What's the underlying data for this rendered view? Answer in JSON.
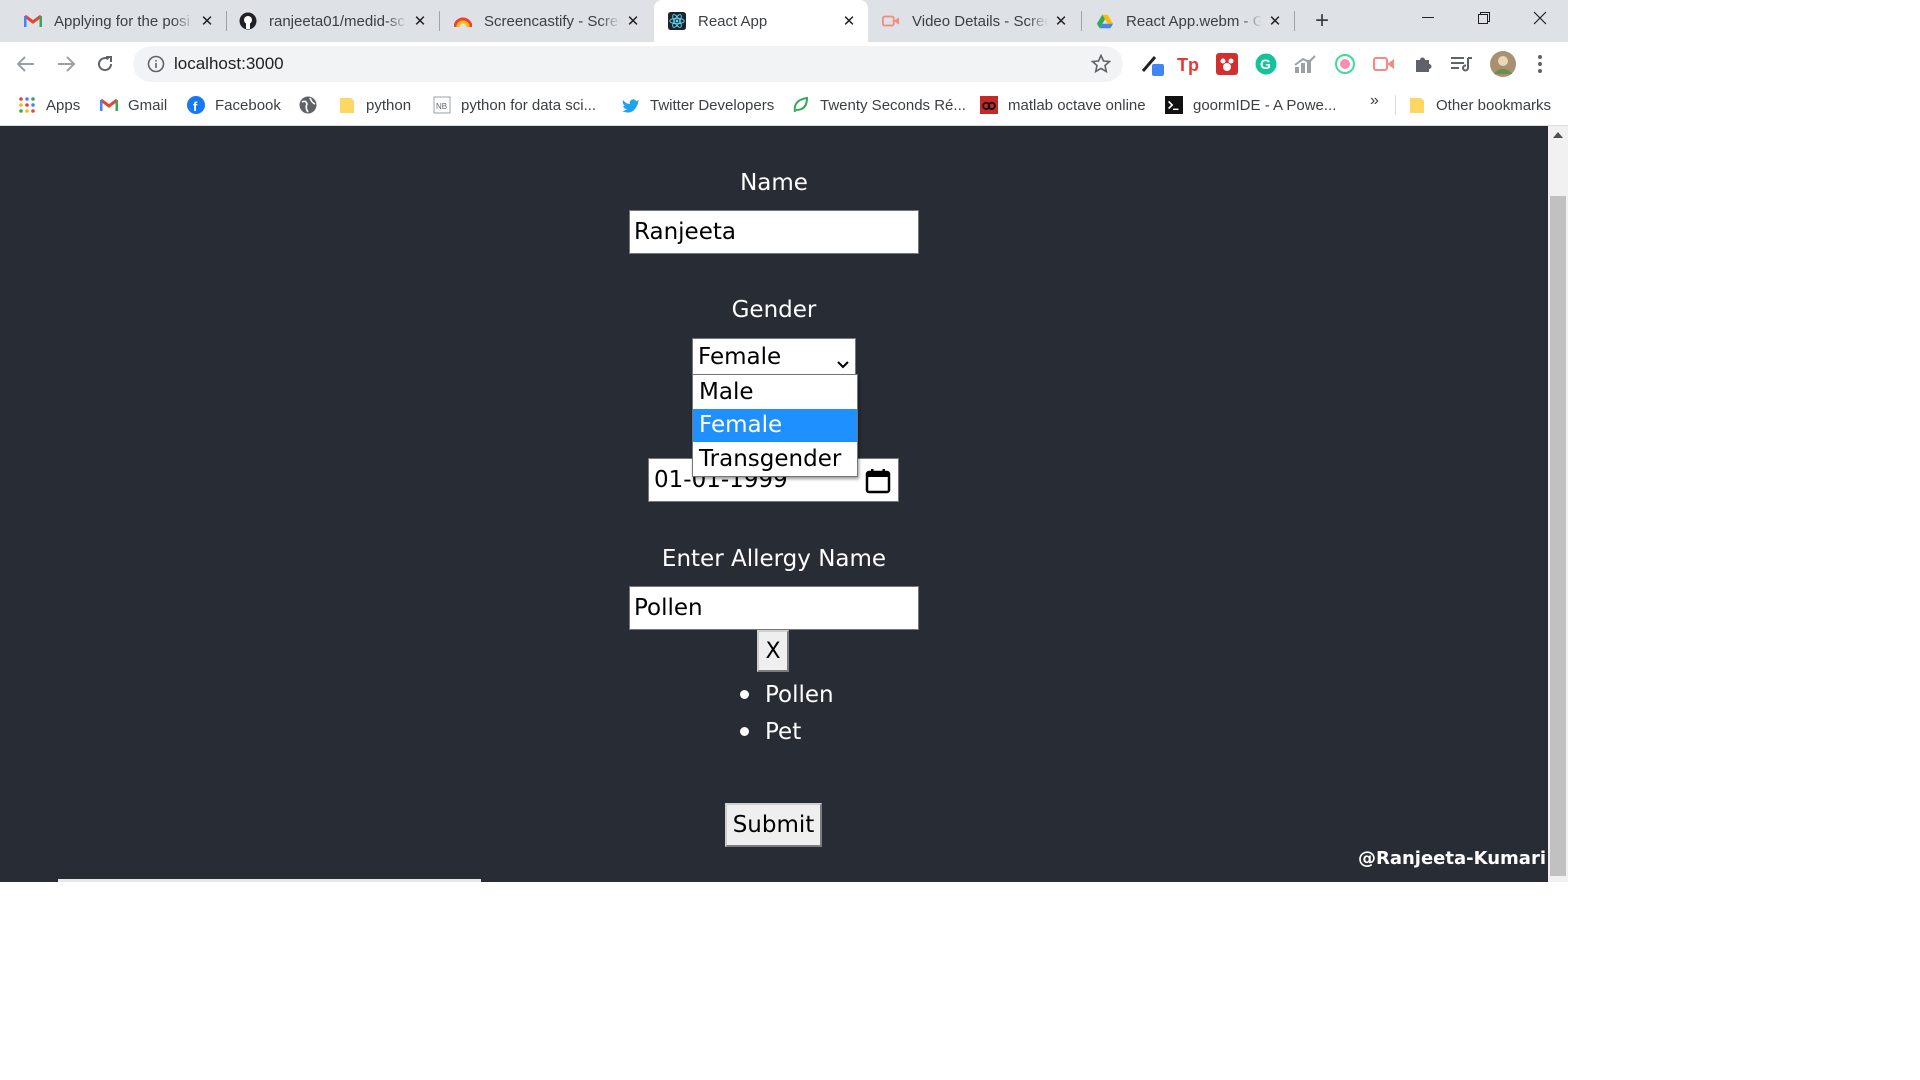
{
  "browser": {
    "tabs": [
      {
        "title": "Applying for the posi",
        "icon": "gmail-icon",
        "active": false
      },
      {
        "title": "ranjeeta01/medid-sc",
        "icon": "github-icon",
        "active": false
      },
      {
        "title": "Screencastify - Scree",
        "icon": "screencastify-icon",
        "active": false
      },
      {
        "title": "React App",
        "icon": "react-icon",
        "active": true
      },
      {
        "title": "Video Details - Scree",
        "icon": "video-icon",
        "active": false
      },
      {
        "title": "React App.webm - G",
        "icon": "google-drive-icon",
        "active": false
      }
    ],
    "url": "localhost:3000",
    "bookmarks": [
      {
        "label": "Apps",
        "icon": "apps-grid-icon"
      },
      {
        "label": "Gmail",
        "icon": "gmail-icon"
      },
      {
        "label": "Facebook",
        "icon": "facebook-icon"
      },
      {
        "label": "",
        "icon": "globe-icon"
      },
      {
        "label": "python",
        "icon": "folder-icon"
      },
      {
        "label": "python for data sci...",
        "icon": "notebook-icon"
      },
      {
        "label": "Twitter Developers",
        "icon": "twitter-icon"
      },
      {
        "label": "Twenty Seconds Ré...",
        "icon": "leaf-icon"
      },
      {
        "label": "matlab octave online",
        "icon": "octave-icon"
      },
      {
        "label": "goormIDE - A Powe...",
        "icon": "terminal-icon"
      }
    ],
    "bookmarks_overflow": "»",
    "other_bookmarks": "Other bookmarks"
  },
  "form": {
    "name_label": "Name",
    "name_value": "Ranjeeta",
    "gender_label": "Gender",
    "gender_selected": "Female",
    "gender_options": [
      "Male",
      "Female",
      "Transgender"
    ],
    "dob_value": "01-01-1999",
    "allergy_label": "Enter Allergy Name",
    "allergy_value": "Pollen",
    "remove_button": "X",
    "allergies": [
      "Pollen",
      "Pet"
    ],
    "submit_label": "Submit"
  },
  "watermark": "@Ranjeeta-Kumari",
  "colors": {
    "page_bg": "#282c34",
    "option_highlight": "#1e90ff",
    "tabstrip_bg": "#dee1e6"
  }
}
